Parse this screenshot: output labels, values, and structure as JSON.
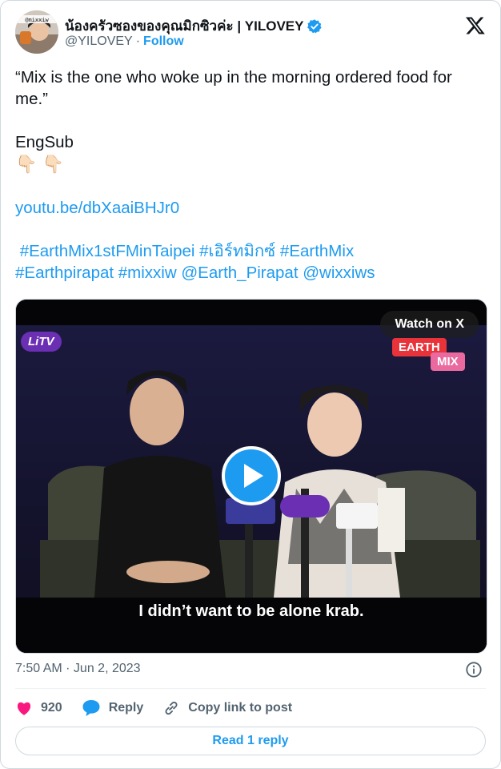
{
  "author": {
    "display_name": "น้องครัวซองของคุณมิกซิวค่ะ | YILOVEY",
    "handle": "@YILOVEY",
    "separator": "·",
    "follow_label": "Follow",
    "avatar_text": "@mixxiw",
    "verified_icon": "verified-badge-icon",
    "verified_color": "#1d9bf0"
  },
  "brand_icon": "x-logo-icon",
  "tweet": {
    "line1": "“Mix is the one who woke up in the morning ordered food for me.”",
    "line2": "EngSub",
    "emoji": "👇🏻 👇🏻",
    "link": "youtu.be/dbXaaiBHJr0",
    "hashtags_line1": " #EarthMix1stFMinTaipei #เอิร์ทมิกซ์ #EarthMix",
    "hashtags_line2": "#Earthpirapat #mixxiw @Earth_Pirapat @wixxiws"
  },
  "media": {
    "watch_label": "Watch on X",
    "subtitle": "I didn’t want to be alone krab.",
    "channel_logo": "LiTV",
    "tag_earth": "EARTH",
    "tag_mix": "MIX",
    "play_icon": "play-icon"
  },
  "meta": {
    "timestamp": "7:50 AM · Jun 2, 2023",
    "info_icon": "info-icon"
  },
  "actions": {
    "like_count": "920",
    "like_icon": "heart-icon",
    "reply_label": "Reply",
    "reply_icon": "speech-bubble-icon",
    "copy_label": "Copy link to post",
    "copy_icon": "link-icon"
  },
  "read_reply_label": "Read 1 reply",
  "colors": {
    "accent": "#1d9bf0",
    "like": "#f91880",
    "text": "#0f1419",
    "secondary": "#536471"
  }
}
